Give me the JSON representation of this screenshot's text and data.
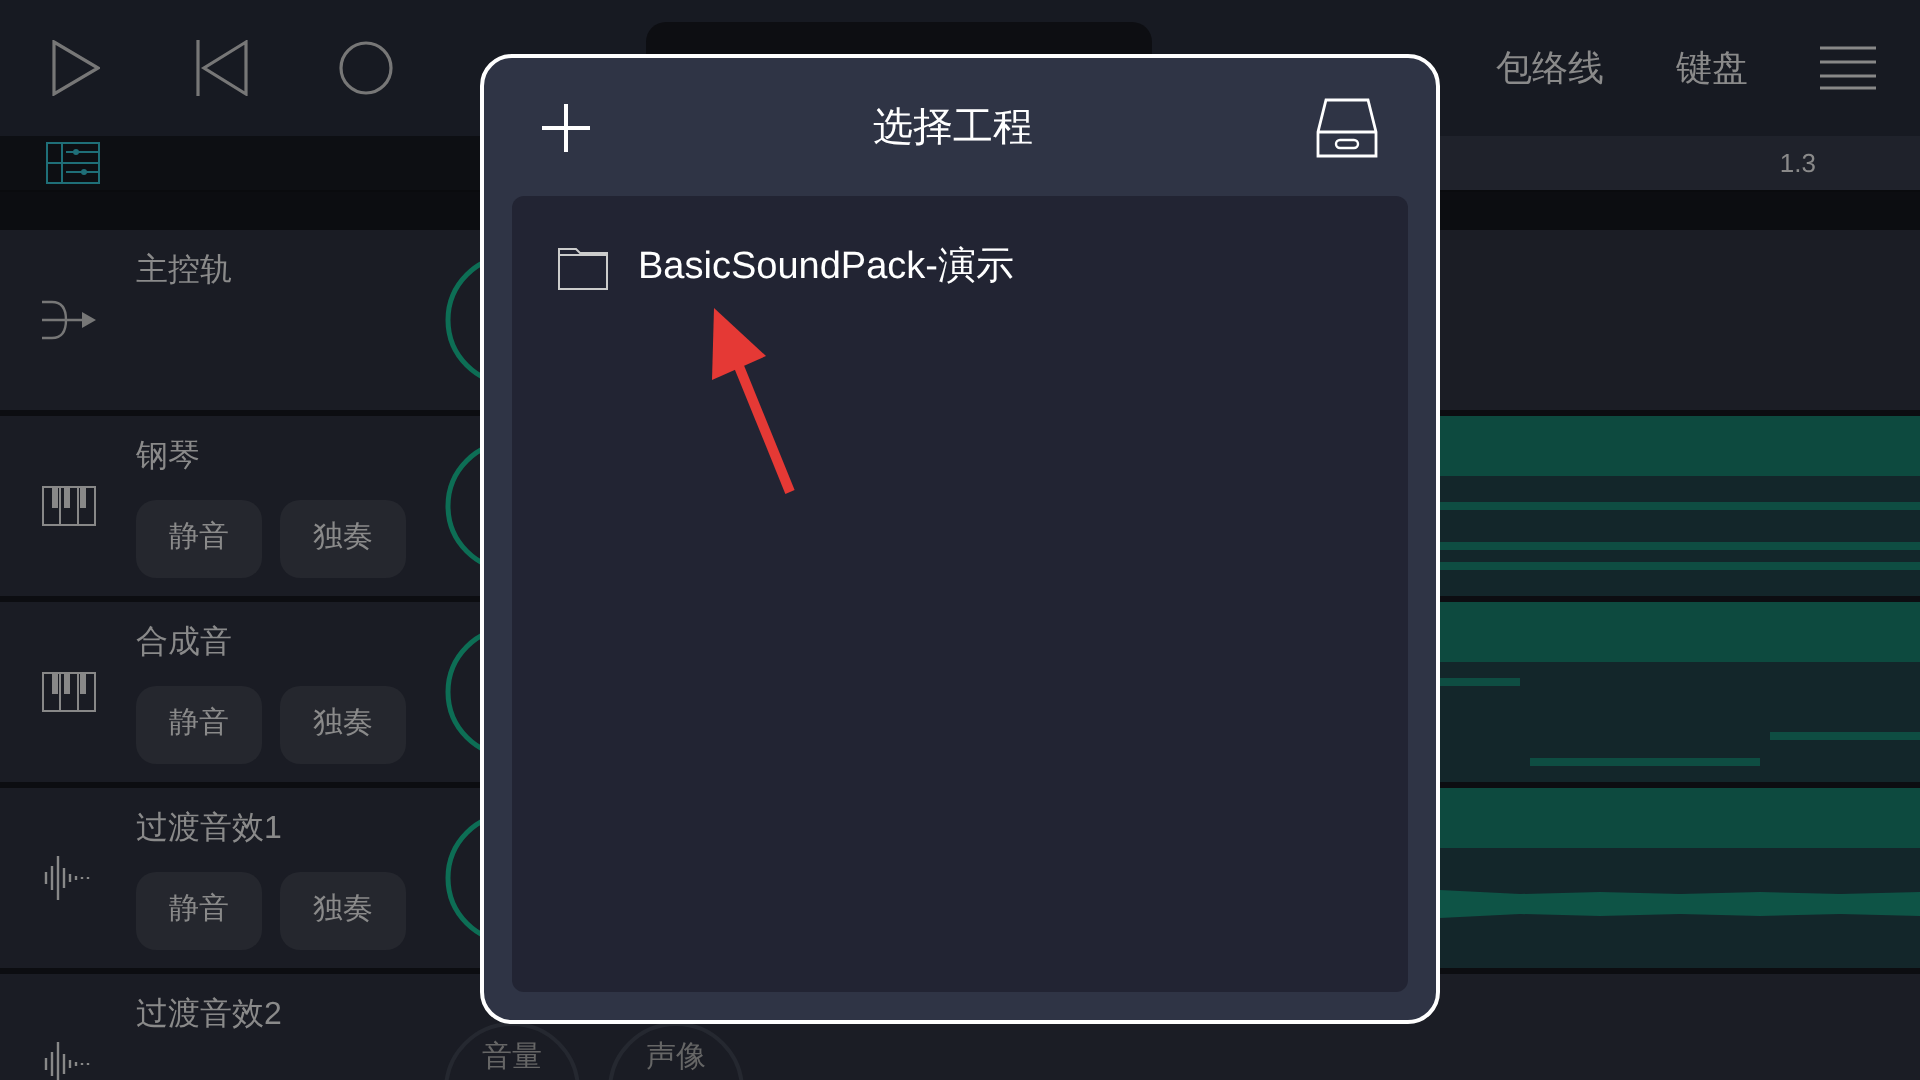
{
  "toolbar": {
    "tabs": [
      "包络线",
      "键盘"
    ]
  },
  "ruler": {
    "marks": [
      "1.3"
    ]
  },
  "tracks": [
    {
      "name": "主控轨",
      "kind": "master"
    },
    {
      "name": "钢琴",
      "kind": "instrument",
      "buttons": [
        "静音",
        "独奏"
      ]
    },
    {
      "name": "合成音",
      "kind": "instrument",
      "buttons": [
        "静音",
        "独奏"
      ]
    },
    {
      "name": "过渡音效1",
      "kind": "audio",
      "buttons": [
        "静音",
        "独奏"
      ]
    },
    {
      "name": "过渡音效2",
      "kind": "audio",
      "knob_labels": [
        "音量",
        "声像"
      ]
    }
  ],
  "dialog": {
    "title": "选择工程",
    "items": [
      {
        "name": "BasicSoundPack-演示"
      }
    ]
  }
}
